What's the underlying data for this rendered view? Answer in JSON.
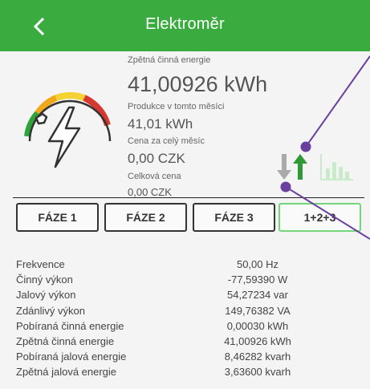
{
  "header": {
    "title": "Elektroměr",
    "back_icon": "chevron-left-icon",
    "background": "#3aac3f"
  },
  "meter": {
    "gauge_icon": "electricity-gauge-icon",
    "reverse_energy_label": "Zpětná činná energie",
    "reverse_energy_value": "41,00926 kWh",
    "production_label": "Produkce v tomto měsíci",
    "production_value": "41,01 kWh",
    "month_price_label": "Cena za celý měsíc",
    "month_price_value": "0,00 CZK",
    "total_price_label": "Celková cena",
    "total_price_value": "0,00 CZK"
  },
  "icons": {
    "down_arrow": "arrow-down-icon",
    "up_arrow": "arrow-up-icon",
    "chart": "bar-chart-icon",
    "up_arrow_color": "#2e9a35",
    "down_arrow_color": "#aaaaaa"
  },
  "phases": {
    "tabs": [
      {
        "label": "FÁZE 1"
      },
      {
        "label": "FÁZE 2"
      },
      {
        "label": "FÁZE 3"
      },
      {
        "label": "1+2+3"
      }
    ],
    "active_index": 3
  },
  "measurements": [
    {
      "name": "Frekvence",
      "value": "50,00 Hz"
    },
    {
      "name": "Činný výkon",
      "value": "-77,59390 W"
    },
    {
      "name": "Jalový výkon",
      "value": "54,27234 var"
    },
    {
      "name": "Zdánlivý výkon",
      "value": "149,76382 VA"
    },
    {
      "name": "Pobíraná činná energie",
      "value": "0,00030 kWh"
    },
    {
      "name": "Zpětná činná energie",
      "value": "41,00926 kWh"
    },
    {
      "name": "Pobíraná jalová energie",
      "value": "8,46282 kvarh"
    },
    {
      "name": "Zpětná jalová energie",
      "value": "3,63600 kvarh"
    }
  ]
}
